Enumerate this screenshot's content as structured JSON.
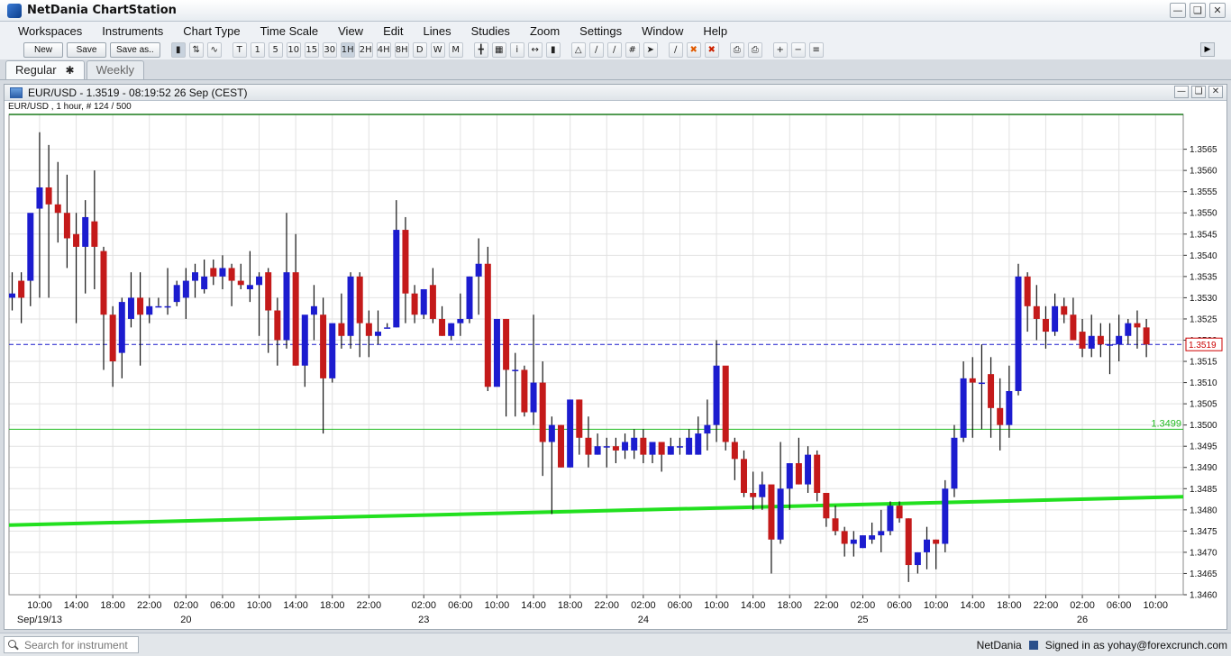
{
  "app": {
    "title": "NetDania ChartStation"
  },
  "menu": [
    "Workspaces",
    "Instruments",
    "Chart Type",
    "Time Scale",
    "View",
    "Edit",
    "Lines",
    "Studies",
    "Zoom",
    "Settings",
    "Window",
    "Help"
  ],
  "toolbar": {
    "new_label": "New",
    "save_label": "Save",
    "saveas_label": "Save as..",
    "timeframes": [
      "T",
      "1",
      "5",
      "10",
      "15",
      "30",
      "1H",
      "2H",
      "4H",
      "8H",
      "D",
      "W",
      "M"
    ]
  },
  "tabs": [
    {
      "label": "Regular",
      "active": true
    },
    {
      "label": "Weekly",
      "active": false
    }
  ],
  "chart_window": {
    "title": "EUR/USD - 1.3519 - 08:19:52  26 Sep (CEST)",
    "subtitle": "EUR/USD , 1 hour, # 124 / 500"
  },
  "status": {
    "search_placeholder": "Search for instrument",
    "brand": "NetDania",
    "signed_in": "Signed in as yohay@forexcrunch.com"
  },
  "chart_data": {
    "type": "candlestick",
    "instrument": "EUR/USD",
    "interval": "1 hour",
    "ylim": [
      1.346,
      1.357
    ],
    "yticks": [
      1.346,
      1.3465,
      1.347,
      1.3475,
      1.348,
      1.3485,
      1.349,
      1.3495,
      1.35,
      1.3505,
      1.351,
      1.3515,
      1.352,
      1.3525,
      1.353,
      1.3535,
      1.354,
      1.3545,
      1.355,
      1.3555,
      1.356,
      1.3565
    ],
    "ytick_labels": [
      "1.3460",
      "1.3465",
      "1.3470",
      "1.3475",
      "1.3480",
      "1.3485",
      "1.3490",
      "1.3495",
      "1.3500",
      "1.3505",
      "1.3510",
      "1.3515",
      "1.3520",
      "1.3525",
      "1.3530",
      "1.3535",
      "1.3540",
      "1.3545",
      "1.3550",
      "1.3555",
      "1.3560",
      "1.3565"
    ],
    "xticks": [
      {
        "i": 3,
        "label": "10:00",
        "date": "Sep/19/13"
      },
      {
        "i": 7,
        "label": "14:00"
      },
      {
        "i": 11,
        "label": "18:00"
      },
      {
        "i": 15,
        "label": "22:00"
      },
      {
        "i": 19,
        "label": "02:00",
        "date": "20"
      },
      {
        "i": 23,
        "label": "06:00"
      },
      {
        "i": 27,
        "label": "10:00"
      },
      {
        "i": 31,
        "label": "14:00"
      },
      {
        "i": 35,
        "label": "18:00"
      },
      {
        "i": 39,
        "label": "22:00"
      },
      {
        "i": 45,
        "label": "02:00",
        "date": "23"
      },
      {
        "i": 49,
        "label": "06:00"
      },
      {
        "i": 53,
        "label": "10:00"
      },
      {
        "i": 57,
        "label": "14:00"
      },
      {
        "i": 61,
        "label": "18:00"
      },
      {
        "i": 65,
        "label": "22:00"
      },
      {
        "i": 69,
        "label": "02:00",
        "date": "24"
      },
      {
        "i": 73,
        "label": "06:00"
      },
      {
        "i": 77,
        "label": "10:00"
      },
      {
        "i": 81,
        "label": "14:00"
      },
      {
        "i": 85,
        "label": "18:00"
      },
      {
        "i": 89,
        "label": "22:00"
      },
      {
        "i": 93,
        "label": "02:00",
        "date": "25"
      },
      {
        "i": 97,
        "label": "06:00"
      },
      {
        "i": 101,
        "label": "10:00"
      },
      {
        "i": 105,
        "label": "14:00"
      },
      {
        "i": 109,
        "label": "18:00"
      },
      {
        "i": 113,
        "label": "22:00"
      },
      {
        "i": 117,
        "label": "02:00",
        "date": "26"
      },
      {
        "i": 121,
        "label": "06:00"
      },
      {
        "i": 125,
        "label": "10:00"
      }
    ],
    "candles": [
      [
        1.353,
        1.3536,
        1.3527,
        1.3531
      ],
      [
        1.3534,
        1.3536,
        1.3524,
        1.353
      ],
      [
        1.3534,
        1.354,
        1.3528,
        1.355
      ],
      [
        1.3551,
        1.3569,
        1.353,
        1.3556
      ],
      [
        1.3556,
        1.3566,
        1.353,
        1.3552
      ],
      [
        1.3552,
        1.3562,
        1.3543,
        1.355
      ],
      [
        1.355,
        1.3559,
        1.3537,
        1.3544
      ],
      [
        1.3545,
        1.355,
        1.3524,
        1.3542
      ],
      [
        1.3542,
        1.3553,
        1.3531,
        1.3549
      ],
      [
        1.3548,
        1.356,
        1.3532,
        1.3542
      ],
      [
        1.3541,
        1.3542,
        1.3513,
        1.3526
      ],
      [
        1.3526,
        1.3528,
        1.3509,
        1.3515
      ],
      [
        1.3517,
        1.353,
        1.3511,
        1.3529
      ],
      [
        1.3525,
        1.3536,
        1.3523,
        1.353
      ],
      [
        1.353,
        1.3536,
        1.3514,
        1.3526
      ],
      [
        1.3526,
        1.353,
        1.3524,
        1.3528
      ],
      [
        1.3528,
        1.353,
        1.3528,
        1.3528
      ],
      [
        1.3528,
        1.3537,
        1.3526,
        1.3528
      ],
      [
        1.3529,
        1.3534,
        1.3528,
        1.3533
      ],
      [
        1.353,
        1.3537,
        1.3525,
        1.3534
      ],
      [
        1.3534,
        1.3538,
        1.353,
        1.3536
      ],
      [
        1.3532,
        1.3539,
        1.3531,
        1.3535
      ],
      [
        1.3537,
        1.3539,
        1.3533,
        1.3535
      ],
      [
        1.3535,
        1.354,
        1.3532,
        1.3537
      ],
      [
        1.3537,
        1.3538,
        1.3528,
        1.3534
      ],
      [
        1.3534,
        1.3538,
        1.3532,
        1.3533
      ],
      [
        1.3532,
        1.3541,
        1.3529,
        1.3533
      ],
      [
        1.3533,
        1.3536,
        1.3521,
        1.3535
      ],
      [
        1.3536,
        1.3537,
        1.3517,
        1.3527
      ],
      [
        1.3527,
        1.353,
        1.3514,
        1.352
      ],
      [
        1.352,
        1.355,
        1.3518,
        1.3536
      ],
      [
        1.3536,
        1.3545,
        1.3514,
        1.3514
      ],
      [
        1.3514,
        1.3524,
        1.3509,
        1.3526
      ],
      [
        1.3526,
        1.3533,
        1.352,
        1.3528
      ],
      [
        1.3526,
        1.353,
        1.3498,
        1.3511
      ],
      [
        1.3511,
        1.3523,
        1.351,
        1.3524
      ],
      [
        1.3524,
        1.3531,
        1.3518,
        1.3521
      ],
      [
        1.3521,
        1.3536,
        1.3518,
        1.3535
      ],
      [
        1.3535,
        1.3536,
        1.3516,
        1.3524
      ],
      [
        1.3524,
        1.3527,
        1.3516,
        1.3521
      ],
      [
        1.3521,
        1.3527,
        1.3519,
        1.3522
      ],
      [
        1.3523,
        1.3524,
        1.3523,
        1.3523
      ],
      [
        1.3523,
        1.3553,
        1.3523,
        1.3546
      ],
      [
        1.3546,
        1.3549,
        1.3524,
        1.3531
      ],
      [
        1.3531,
        1.3533,
        1.3524,
        1.3526
      ],
      [
        1.3526,
        1.3531,
        1.3525,
        1.3532
      ],
      [
        1.3533,
        1.3537,
        1.3524,
        1.3525
      ],
      [
        1.3525,
        1.3528,
        1.3521,
        1.3521
      ],
      [
        1.3521,
        1.3524,
        1.352,
        1.3524
      ],
      [
        1.3524,
        1.3531,
        1.3521,
        1.3525
      ],
      [
        1.3525,
        1.3535,
        1.3524,
        1.3535
      ],
      [
        1.3535,
        1.3544,
        1.3526,
        1.3538
      ],
      [
        1.3538,
        1.3542,
        1.3508,
        1.3509
      ],
      [
        1.3509,
        1.3525,
        1.351,
        1.3525
      ],
      [
        1.3525,
        1.3525,
        1.3502,
        1.3513
      ],
      [
        1.3513,
        1.3517,
        1.3502,
        1.3513
      ],
      [
        1.3513,
        1.3514,
        1.3502,
        1.3503
      ],
      [
        1.3503,
        1.3526,
        1.35,
        1.351
      ],
      [
        1.351,
        1.3515,
        1.3488,
        1.3496
      ],
      [
        1.3496,
        1.3502,
        1.3479,
        1.35
      ],
      [
        1.35,
        1.35,
        1.349,
        1.349
      ],
      [
        1.349,
        1.3506,
        1.349,
        1.3506
      ],
      [
        1.3506,
        1.3506,
        1.3493,
        1.3497
      ],
      [
        1.3497,
        1.3502,
        1.349,
        1.3493
      ],
      [
        1.3493,
        1.3498,
        1.3493,
        1.3495
      ],
      [
        1.3495,
        1.3497,
        1.349,
        1.3495
      ],
      [
        1.3495,
        1.3497,
        1.3491,
        1.3494
      ],
      [
        1.3494,
        1.3498,
        1.3492,
        1.3496
      ],
      [
        1.3494,
        1.3499,
        1.3492,
        1.3497
      ],
      [
        1.3497,
        1.3499,
        1.3491,
        1.3493
      ],
      [
        1.3493,
        1.3496,
        1.3491,
        1.3496
      ],
      [
        1.3496,
        1.3496,
        1.3489,
        1.3493
      ],
      [
        1.3493,
        1.3497,
        1.3493,
        1.3495
      ],
      [
        1.3495,
        1.3497,
        1.3493,
        1.3495
      ],
      [
        1.3493,
        1.3499,
        1.3493,
        1.3497
      ],
      [
        1.3493,
        1.3502,
        1.3493,
        1.3498
      ],
      [
        1.3498,
        1.3506,
        1.3494,
        1.35
      ],
      [
        1.35,
        1.352,
        1.3496,
        1.3514
      ],
      [
        1.3514,
        1.3513,
        1.3494,
        1.3496
      ],
      [
        1.3496,
        1.3497,
        1.3487,
        1.3492
      ],
      [
        1.3492,
        1.3494,
        1.3483,
        1.3484
      ],
      [
        1.3484,
        1.3489,
        1.348,
        1.3483
      ],
      [
        1.3483,
        1.3489,
        1.348,
        1.3486
      ],
      [
        1.3486,
        1.3485,
        1.3465,
        1.3473
      ],
      [
        1.3473,
        1.3496,
        1.3472,
        1.3485
      ],
      [
        1.3485,
        1.3491,
        1.348,
        1.3491
      ],
      [
        1.3491,
        1.3497,
        1.3486,
        1.3486
      ],
      [
        1.3486,
        1.3495,
        1.3484,
        1.3493
      ],
      [
        1.3493,
        1.3494,
        1.3482,
        1.3484
      ],
      [
        1.3484,
        1.3484,
        1.3476,
        1.3478
      ],
      [
        1.3478,
        1.3481,
        1.3474,
        1.3475
      ],
      [
        1.3475,
        1.3476,
        1.3469,
        1.3472
      ],
      [
        1.3472,
        1.3475,
        1.3469,
        1.3473
      ],
      [
        1.3471,
        1.3474,
        1.3471,
        1.3474
      ],
      [
        1.3473,
        1.3477,
        1.3472,
        1.3474
      ],
      [
        1.3474,
        1.348,
        1.347,
        1.3475
      ],
      [
        1.3475,
        1.3482,
        1.3474,
        1.3481
      ],
      [
        1.3481,
        1.3482,
        1.3477,
        1.3478
      ],
      [
        1.3478,
        1.3478,
        1.3463,
        1.3467
      ],
      [
        1.3467,
        1.347,
        1.3465,
        1.347
      ],
      [
        1.347,
        1.3476,
        1.3466,
        1.3473
      ],
      [
        1.3473,
        1.3473,
        1.3466,
        1.3472
      ],
      [
        1.3472,
        1.3487,
        1.347,
        1.3485
      ],
      [
        1.3485,
        1.35,
        1.3483,
        1.3497
      ],
      [
        1.3497,
        1.3515,
        1.3496,
        1.3511
      ],
      [
        1.3511,
        1.3516,
        1.3497,
        1.351
      ],
      [
        1.351,
        1.3519,
        1.3499,
        1.351
      ],
      [
        1.3512,
        1.3516,
        1.3497,
        1.3504
      ],
      [
        1.3504,
        1.3511,
        1.3494,
        1.35
      ],
      [
        1.35,
        1.3514,
        1.3497,
        1.3508
      ],
      [
        1.3508,
        1.3538,
        1.3507,
        1.3535
      ],
      [
        1.3535,
        1.3536,
        1.3522,
        1.3528
      ],
      [
        1.3528,
        1.3533,
        1.352,
        1.3525
      ],
      [
        1.3525,
        1.3528,
        1.3518,
        1.3522
      ],
      [
        1.3522,
        1.3531,
        1.3521,
        1.3528
      ],
      [
        1.3528,
        1.353,
        1.3524,
        1.3526
      ],
      [
        1.3526,
        1.353,
        1.352,
        1.352
      ],
      [
        1.3522,
        1.3525,
        1.3516,
        1.3518
      ],
      [
        1.3518,
        1.3526,
        1.3516,
        1.3521
      ],
      [
        1.3521,
        1.3524,
        1.3516,
        1.3519
      ],
      [
        1.3519,
        1.3524,
        1.3512,
        1.3519
      ],
      [
        1.3519,
        1.3526,
        1.3515,
        1.3521
      ],
      [
        1.3521,
        1.3525,
        1.3519,
        1.3524
      ],
      [
        1.3524,
        1.3527,
        1.3518,
        1.3523
      ],
      [
        1.3523,
        1.3525,
        1.3516,
        1.3519
      ]
    ],
    "current_price": {
      "value": 1.3519,
      "label": "1.3519",
      "color": "#cc0000",
      "line_color": "#1a1acc"
    },
    "hline": {
      "value": 1.3499,
      "label": "1.3499",
      "color": "#22bb22"
    },
    "trendline": {
      "from": [
        0,
        1.34764
      ],
      "to": [
        128,
        1.34831
      ],
      "color": "#22e01f"
    },
    "colors": {
      "up": "#1c1ccf",
      "down": "#c41a1a",
      "wick": "#111111",
      "grid": "#e2e2e2",
      "frame": "#1a7a1a"
    }
  }
}
